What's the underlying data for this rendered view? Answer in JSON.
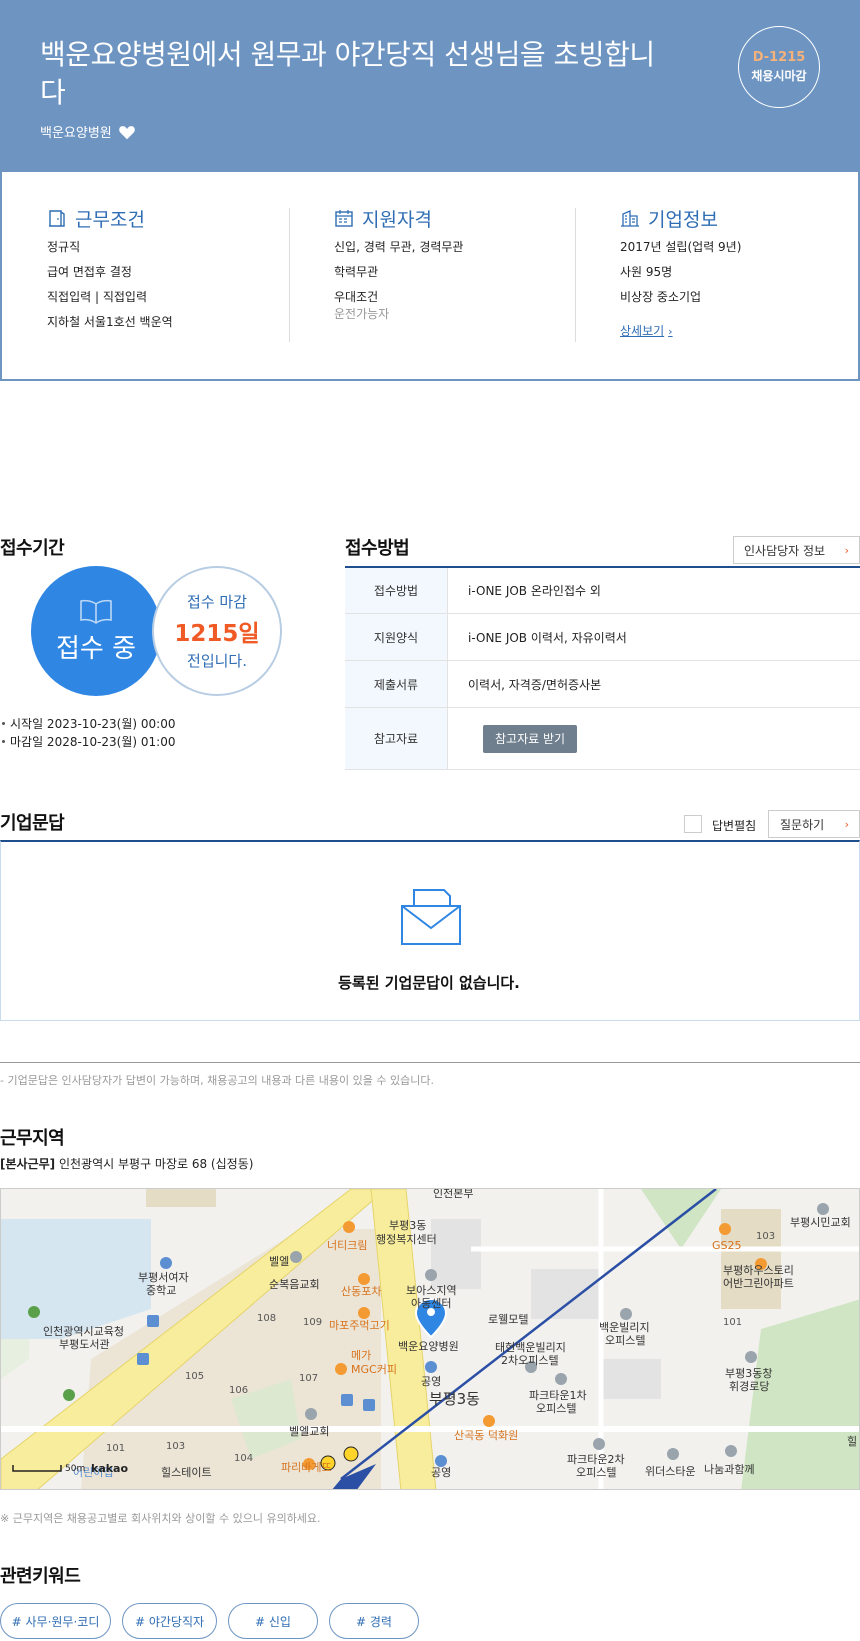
{
  "header": {
    "title": "백운요양병원에서 원무과 야간당직 선생님을 초빙합니다",
    "company": "백운요양병원",
    "dday": "D-1215",
    "dday_sub": "채용시마감"
  },
  "summary": {
    "work": {
      "title": "근무조건",
      "lines": [
        "정규직",
        "급여 면접후 결정",
        "직접입력 | 직접입력",
        "지하철 서울1호선 백운역"
      ]
    },
    "qual": {
      "title": "지원자격",
      "lines": [
        "신입, 경력 무관, 경력무관",
        "학력무관",
        "우대조건"
      ],
      "sub": "운전가능자"
    },
    "company": {
      "title": "기업정보",
      "lines": [
        "2017년 설립(업력 9년)",
        "사원 95명",
        "비상장 중소기업"
      ],
      "link": "상세보기"
    }
  },
  "period": {
    "title": "접수기간",
    "status": "접수 중",
    "deadline_top": "접수 마감",
    "deadline_days": "1215일",
    "deadline_bottom": "전입니다.",
    "start": "시작일 2023-10-23(월) 00:00",
    "end": "마감일 2028-10-23(월) 01:00"
  },
  "method": {
    "title": "접수방법",
    "hr_button": "인사담당자 정보",
    "rows": [
      {
        "label": "접수방법",
        "value": "i-ONE JOB 온라인접수 외"
      },
      {
        "label": "지원양식",
        "value": "i-ONE JOB 이력서, 자유이력서"
      },
      {
        "label": "제출서류",
        "value": "이력서, 자격증/면허증사본"
      },
      {
        "label": "참고자료",
        "button": "참고자료 받기"
      }
    ]
  },
  "qa": {
    "title": "기업문답",
    "checkbox_label": "답변펼침",
    "ask_button": "질문하기",
    "empty": "등록된 기업문답이 없습니다.",
    "note": "- 기업문답은 인사담당자가 답변이 가능하며, 채용공고의 내용과 다른 내용이 있을 수 있습니다."
  },
  "location": {
    "title": "근무지역",
    "tag": "[본사근무]",
    "address": "인천광역시 부평구 마장로 68 (십정동)",
    "note": "※ 근무지역은 채용공고별로 회사위치와 상이할 수 있으니 유의하세요.",
    "map_labels": {
      "l1": "인천본부",
      "l2": "부평3동",
      "l3": "행정복지센터",
      "l4": "너티크림",
      "l5": "벨엘",
      "l6": "순복음교회",
      "l7": "부평서여자",
      "l8": "중학교",
      "l9": "산동포차",
      "l10": "보아스지역",
      "l11": "아동센터",
      "l12": "로웰모텔",
      "l13": "마포주먹고기",
      "l14": "인천광역시교육청",
      "l15": "부평도서관",
      "l16": "메가",
      "l17": "MGC커피",
      "l18": "백운요양병원",
      "l19": "태현백운빌리지",
      "l20": "2차오피스텔",
      "l21": "공영",
      "l22": "부평3동",
      "l23": "파크타운1차",
      "l24": "오피스텔",
      "l25": "백운빌리지",
      "l26": "오피스텔",
      "l27": "GS25",
      "l28": "부평하우스토리",
      "l29": "어반그린아파트",
      "l30": "부평시민교회",
      "l31": "부평3동창",
      "l32": "휘경로당",
      "l33": "벨엘교회",
      "l34": "산곡동 덕화원",
      "l35": "파크타운2차",
      "l36": "오피스텔",
      "l37": "위더스타운",
      "l38": "나눔과함께",
      "l39": "힐스테이트",
      "l40": "파리바게뜨",
      "l41": "공영",
      "l42": "50m",
      "l43": "kakao",
      "l44": "103",
      "l45": "108",
      "l46": "109",
      "l47": "105",
      "l48": "106",
      "l49": "107",
      "l50": "104",
      "l51": "103",
      "l52": "101",
      "l53": "101",
      "l54": "어린이집",
      "l55": "힐"
    }
  },
  "keywords": {
    "title": "관련키워드",
    "items": [
      "# 사무·원무·코디",
      "# 야간당직자",
      "# 신입",
      "# 경력"
    ]
  },
  "colors": {
    "header_bg": "#6e95c2",
    "accent_blue": "#2f86e3",
    "accent_orange": "#f05a24",
    "navy": "#1f4e8c"
  }
}
